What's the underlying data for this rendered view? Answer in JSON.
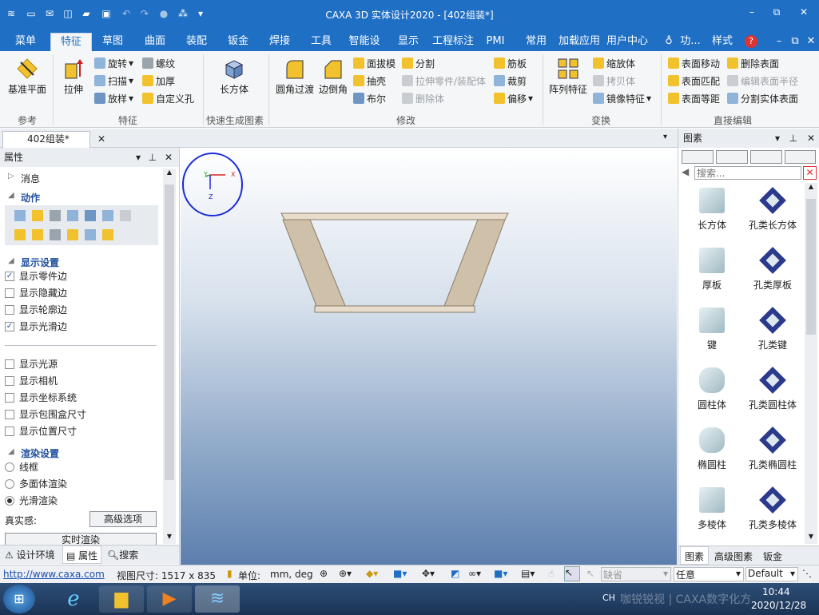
{
  "window": {
    "title": "CAXA 3D 实体设计2020 - [402组装*]",
    "minimize": "–",
    "restore": "⧉",
    "close": "✕"
  },
  "quick_access": {
    "icons": [
      "app-logo-icon",
      "new-icon",
      "mail-icon",
      "options-icon",
      "open-icon",
      "save-icon",
      "undo-icon",
      "redo-icon",
      "record-icon",
      "smart-icon",
      "dropdown-icon"
    ]
  },
  "ribbon_tabs": [
    "菜单",
    "特征",
    "草图",
    "曲面",
    "装配",
    "钣金",
    "焊接",
    "工具",
    "智能设计:",
    "显示",
    "工程标注",
    "PMI",
    "常用",
    "加载应用",
    "用户中心"
  ],
  "active_tab": "特征",
  "ribbon_right": {
    "help_placeholder": "功...",
    "style": "样式",
    "help": "?"
  },
  "ribbon": {
    "ref": {
      "label": "参考",
      "plane": "基准平面"
    },
    "feature": {
      "label": "特征",
      "extrude": "拉伸",
      "rotate": "旋转",
      "sweep": "扫描",
      "loft": "放样",
      "thread": "螺纹",
      "thicken": "加厚",
      "custom_hole": "自定义孔"
    },
    "quick": {
      "label": "快速生成图素",
      "box": "长方体"
    },
    "modify": {
      "label": "修改",
      "fillet": "圆角过渡",
      "chamfer": "边倒角",
      "draft": "面拔模",
      "shell": "抽壳",
      "boolean": "布尔",
      "split": "分割",
      "extrude_part": "拉伸零件/装配体",
      "delete_body": "删除体",
      "rib": "筋板",
      "trim": "裁剪",
      "offset": "偏移"
    },
    "transform": {
      "label": "变换",
      "pattern": "阵列特征",
      "scale": "缩放体",
      "copy": "拷贝体",
      "mirror": "镜像特征"
    },
    "direct": {
      "label": "直接编辑",
      "move_face": "表面移动",
      "match_face": "表面匹配",
      "equal_face": "表面等距",
      "delete_face": "删除表面",
      "edit_radius": "编辑表面半径",
      "split_solid": "分割实体表面"
    }
  },
  "doc_tab": "402组装*",
  "properties": {
    "title": "属性",
    "messages": "消息",
    "actions": "动作",
    "display_settings": "显示设置",
    "checks": [
      {
        "label": "显示零件边",
        "checked": true
      },
      {
        "label": "显示隐藏边",
        "checked": false
      },
      {
        "label": "显示轮廓边",
        "checked": false
      },
      {
        "label": "显示光滑边",
        "checked": true
      }
    ],
    "checks2": [
      {
        "label": "显示光源",
        "checked": false
      },
      {
        "label": "显示相机",
        "checked": false
      },
      {
        "label": "显示坐标系统",
        "checked": false
      },
      {
        "label": "显示包围盒尺寸",
        "checked": false
      },
      {
        "label": "显示位置尺寸",
        "checked": false
      }
    ],
    "render_settings": "渲染设置",
    "render_modes": [
      {
        "label": "线框",
        "selected": false
      },
      {
        "label": "多面体渲染",
        "selected": false
      },
      {
        "label": "光滑渲染",
        "selected": true
      }
    ],
    "realism": "真实感:",
    "advanced": "高级选项",
    "realtime": "实时渲染",
    "bottom_tabs": [
      "设计环境",
      "属性",
      "搜索"
    ]
  },
  "axis": {
    "x": "X",
    "y": "Y",
    "z": "Z"
  },
  "gallery": {
    "title": "图素",
    "search_placeholder": "搜索...",
    "items": [
      {
        "label": "长方体",
        "icon": "box-icon"
      },
      {
        "label": "孔类长方体",
        "icon": "box-hole-icon"
      },
      {
        "label": "厚板",
        "icon": "plate-icon"
      },
      {
        "label": "孔类厚板",
        "icon": "plate-hole-icon"
      },
      {
        "label": "键",
        "icon": "key-icon"
      },
      {
        "label": "孔类键",
        "icon": "key-hole-icon"
      },
      {
        "label": "圆柱体",
        "icon": "cylinder-icon"
      },
      {
        "label": "孔类圆柱体",
        "icon": "cylinder-hole-icon"
      },
      {
        "label": "椭圆柱",
        "icon": "ellipse-cylinder-icon"
      },
      {
        "label": "孔类椭圆柱",
        "icon": "ellipse-hole-icon"
      },
      {
        "label": "多棱体",
        "icon": "prism-icon"
      },
      {
        "label": "孔类多棱体",
        "icon": "prism-hole-icon"
      }
    ],
    "bottom_tabs": [
      "图素",
      "高级图素",
      "钣金"
    ]
  },
  "status": {
    "url": "http://www.caxa.com",
    "view_size": "视图尺寸: 1517 x 835",
    "unit_label": "单位:",
    "unit_value": "mm, deg",
    "select1": "缺省",
    "select2": "任意",
    "select3": "Default"
  },
  "taskbar": {
    "lang": "CH",
    "time": "10:44",
    "date": "2020/12/28",
    "watermark": "咖锐锐视 | CAXA数字化方"
  },
  "colors": {
    "accent": "#1f6fc4",
    "panel": "#f5f6f7"
  }
}
